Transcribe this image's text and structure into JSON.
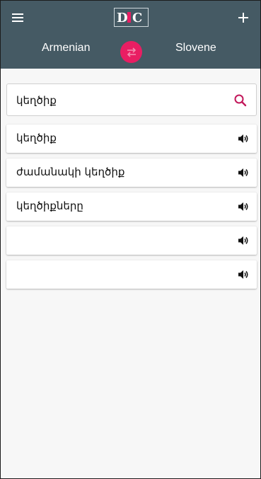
{
  "header": {
    "logo_text": "DIC",
    "menu_icon": "menu-icon",
    "add_icon": "add-icon",
    "background_color": "#455a64"
  },
  "languages": {
    "from": "Armenian",
    "to": "Slovene",
    "swap_icon": "swap-icon",
    "swap_color": "#e91e63"
  },
  "search": {
    "value": "կեղծիք",
    "icon": "search-icon",
    "icon_color": "#c2185b"
  },
  "results": [
    {
      "text": "կեղծիք",
      "icon": "speaker-icon"
    },
    {
      "text": "ժամանակի կեղծիք",
      "icon": "speaker-icon"
    },
    {
      "text": "կեղծիքները",
      "icon": "speaker-icon"
    },
    {
      "text": "",
      "icon": "speaker-icon"
    },
    {
      "text": "",
      "icon": "speaker-icon"
    }
  ]
}
